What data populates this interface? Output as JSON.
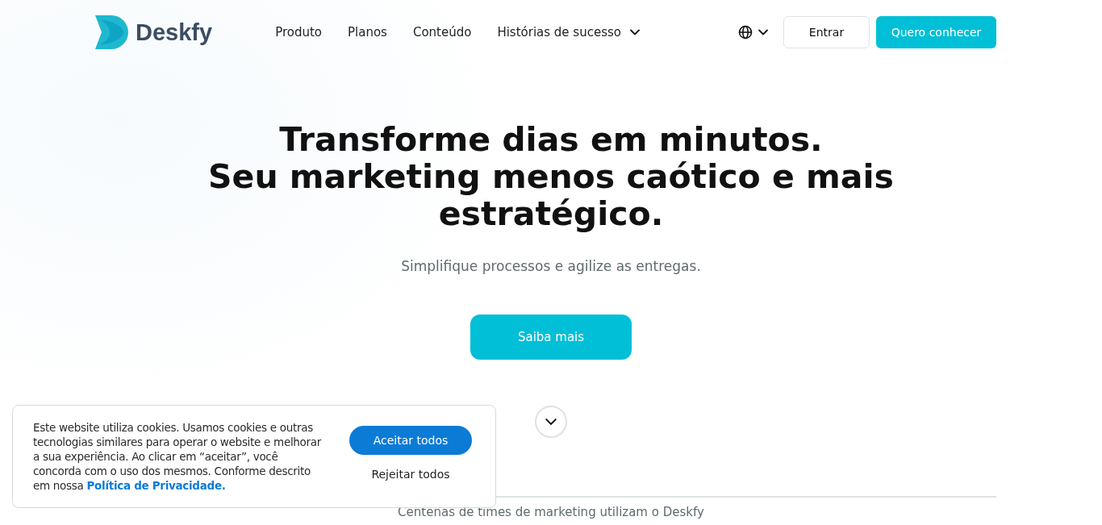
{
  "header": {
    "logo_text": "Deskfy",
    "nav": [
      {
        "label": "Produto",
        "has_dropdown": false
      },
      {
        "label": "Planos",
        "has_dropdown": false
      },
      {
        "label": "Conteúdo",
        "has_dropdown": false
      },
      {
        "label": "Histórias de sucesso",
        "has_dropdown": true
      }
    ],
    "login_button": "Entrar",
    "cta_button": "Quero conhecer"
  },
  "hero": {
    "headline": [
      "Transforme dias em minutos.",
      "Seu marketing menos caótico e mais estratégico."
    ],
    "subtitle": "Simplifique processos e agilize as entregas.",
    "button": "Saiba mais"
  },
  "social_proof": "Centenas de times de marketing utilizam o Deskfy",
  "cookie_banner": {
    "text": "Este website utiliza cookies. Usamos cookies e outras tecnologias similares para operar o website e melhorar a sua experiência. Ao clicar em “aceitar”, você concorda com o uso dos mesmos. Conforme descrito em nossa",
    "link": "Política de Privacidade.",
    "accept": "Aceitar todos",
    "reject": "Rejeitar todos"
  }
}
